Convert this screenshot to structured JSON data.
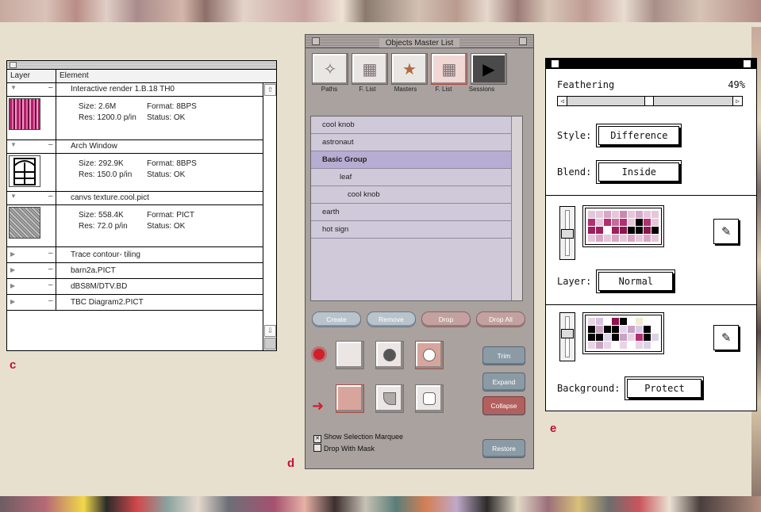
{
  "labels": {
    "c": "c",
    "d": "d",
    "e": "e"
  },
  "panel_c": {
    "headers": {
      "layer": "Layer",
      "element": "Element"
    },
    "items": [
      {
        "name": "Interactive render 1.B.18 TH0",
        "details": [
          [
            "Size: 2.6M",
            "Format: 8BPS"
          ],
          [
            "Res: 1200.0 p/in",
            "Status: OK"
          ]
        ]
      },
      {
        "name": "Arch Window",
        "details": [
          [
            "Size: 292.9K",
            "Format: 8BPS"
          ],
          [
            "Res: 150.0 p/in",
            "Status: OK"
          ]
        ]
      },
      {
        "name": "canvs texture.cool.pict",
        "details": [
          [
            "Size: 558.4K",
            "Format: PICT"
          ],
          [
            "Res: 72.0 p/in",
            "Status: OK"
          ]
        ]
      },
      {
        "name": "Trace contour- tiling"
      },
      {
        "name": "barn2a.PICT"
      },
      {
        "name": "dBS8M/DTV.BD"
      },
      {
        "name": "TBC Diagram2.PICT"
      }
    ]
  },
  "panel_d": {
    "title": "Objects Master List",
    "tabs": [
      "Paths",
      "F. List",
      "Masters",
      "F. List",
      "Sessions"
    ],
    "list": [
      {
        "label": "cool knob",
        "indent": 0,
        "group": false
      },
      {
        "label": "astronaut",
        "indent": 0,
        "group": false
      },
      {
        "label": "Basic Group",
        "indent": 0,
        "group": true
      },
      {
        "label": "leaf",
        "indent": 1,
        "group": false
      },
      {
        "label": "cool knob",
        "indent": 2,
        "group": false
      },
      {
        "label": "earth",
        "indent": 0,
        "group": false
      },
      {
        "label": "hot sign",
        "indent": 0,
        "group": false
      }
    ],
    "buttons": [
      "Create",
      "Remove",
      "Drop",
      "Drop All"
    ],
    "side_buttons": [
      "Trim",
      "Expand",
      "Collapse",
      "Restore"
    ],
    "checkboxes": [
      {
        "label": "Show Selection Marquee",
        "checked": true
      },
      {
        "label": "Drop With Mask",
        "checked": false
      }
    ]
  },
  "panel_e": {
    "feathering_label": "Feathering",
    "feathering_value": "49%",
    "feathering_fraction": 0.49,
    "style_label": "Style:",
    "style_value": "Difference",
    "blend_label": "Blend:",
    "blend_value": "Inside",
    "layer_label": "Layer:",
    "layer_value": "Normal",
    "background_label": "Background:",
    "background_value": "Protect",
    "palette1": [
      "#e6c6da",
      "#e6c6da",
      "#d9a6c6",
      "#e6c6da",
      "#c88ab0",
      "#e6c6da",
      "#d9a6c6",
      "#e6c6da",
      "#e6c6da",
      "#b2306f",
      "#e6c6da",
      "#b2306f",
      "#c56c9d",
      "#b2306f",
      "#e6c6da",
      "#000000",
      "#b2306f",
      "#e6c6da",
      "#9c1f5e",
      "#9c1f5e",
      "#ffffff",
      "#9c1f5e",
      "#8a174f",
      "#000000",
      "#000000",
      "#8a174f",
      "#000000",
      "#e6c6da",
      "#d9a6c6",
      "#e6c6da",
      "#d9a6c6",
      "#e6c6da",
      "#d9a6c6",
      "#e6c6da",
      "#d9a6c6",
      "#e6c6da"
    ],
    "palette2": [
      "#e9d4e6",
      "#d9c2e0",
      "#ffffff",
      "#8a174f",
      "#000000",
      "#ffffff",
      "#f0ecd0",
      "#ffffff",
      "#ffffff",
      "#000000",
      "#c9a3c2",
      "#000000",
      "#000000",
      "#e3d3ea",
      "#c9a3c2",
      "#d9c9e6",
      "#000000",
      "#ffffff",
      "#000000",
      "#000000",
      "#dcd2e6",
      "#000000",
      "#c9a3c2",
      "#e9d4e6",
      "#b2306f",
      "#000000",
      "#dcd2e6",
      "#e9d4e6",
      "#c9a3c2",
      "#e9d4e6",
      "#ffffff",
      "#e9d4e6",
      "#ffffff",
      "#e9d4e6",
      "#dcd2e6",
      "#ffffff"
    ]
  }
}
